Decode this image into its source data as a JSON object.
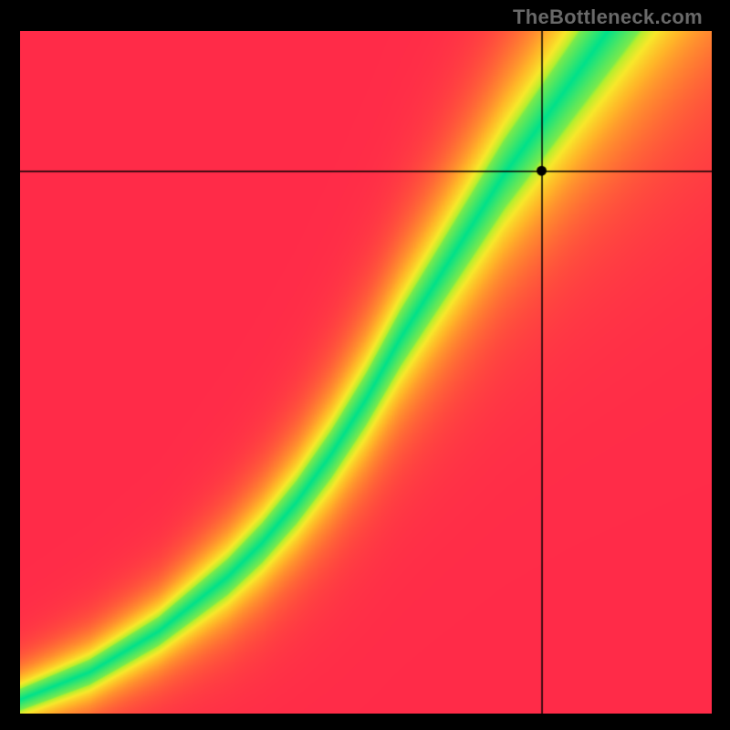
{
  "attribution": "TheBottleneck.com",
  "chart_data": {
    "type": "heatmap",
    "title": "",
    "xlabel": "",
    "ylabel": "",
    "xlim": [
      0,
      1
    ],
    "ylim": [
      0,
      1
    ],
    "marker": {
      "x": 0.755,
      "y": 0.795
    },
    "ridge": [
      {
        "x": 0.0,
        "y": 0.02
      },
      {
        "x": 0.05,
        "y": 0.04
      },
      {
        "x": 0.1,
        "y": 0.06
      },
      {
        "x": 0.15,
        "y": 0.09
      },
      {
        "x": 0.2,
        "y": 0.12
      },
      {
        "x": 0.25,
        "y": 0.16
      },
      {
        "x": 0.3,
        "y": 0.2
      },
      {
        "x": 0.35,
        "y": 0.25
      },
      {
        "x": 0.4,
        "y": 0.31
      },
      {
        "x": 0.45,
        "y": 0.38
      },
      {
        "x": 0.5,
        "y": 0.46
      },
      {
        "x": 0.55,
        "y": 0.55
      },
      {
        "x": 0.6,
        "y": 0.63
      },
      {
        "x": 0.65,
        "y": 0.71
      },
      {
        "x": 0.7,
        "y": 0.79
      },
      {
        "x": 0.75,
        "y": 0.86
      },
      {
        "x": 0.8,
        "y": 0.93
      },
      {
        "x": 0.85,
        "y": 1.0
      }
    ],
    "ridge_width_profile": [
      {
        "x": 0.0,
        "halfwidth": 0.015
      },
      {
        "x": 0.2,
        "halfwidth": 0.02
      },
      {
        "x": 0.4,
        "halfwidth": 0.03
      },
      {
        "x": 0.6,
        "halfwidth": 0.042
      },
      {
        "x": 0.8,
        "halfwidth": 0.055
      },
      {
        "x": 1.0,
        "halfwidth": 0.07
      }
    ],
    "colormap": [
      {
        "t": 0.0,
        "color": "#00e18a"
      },
      {
        "t": 0.18,
        "color": "#b5ef2e"
      },
      {
        "t": 0.35,
        "color": "#f8e82a"
      },
      {
        "t": 0.55,
        "color": "#ffb528"
      },
      {
        "t": 0.75,
        "color": "#ff7a32"
      },
      {
        "t": 0.9,
        "color": "#ff4a3e"
      },
      {
        "t": 1.0,
        "color": "#ff2b48"
      }
    ],
    "crosshair_color": "#000000",
    "marker_color": "#000000"
  }
}
